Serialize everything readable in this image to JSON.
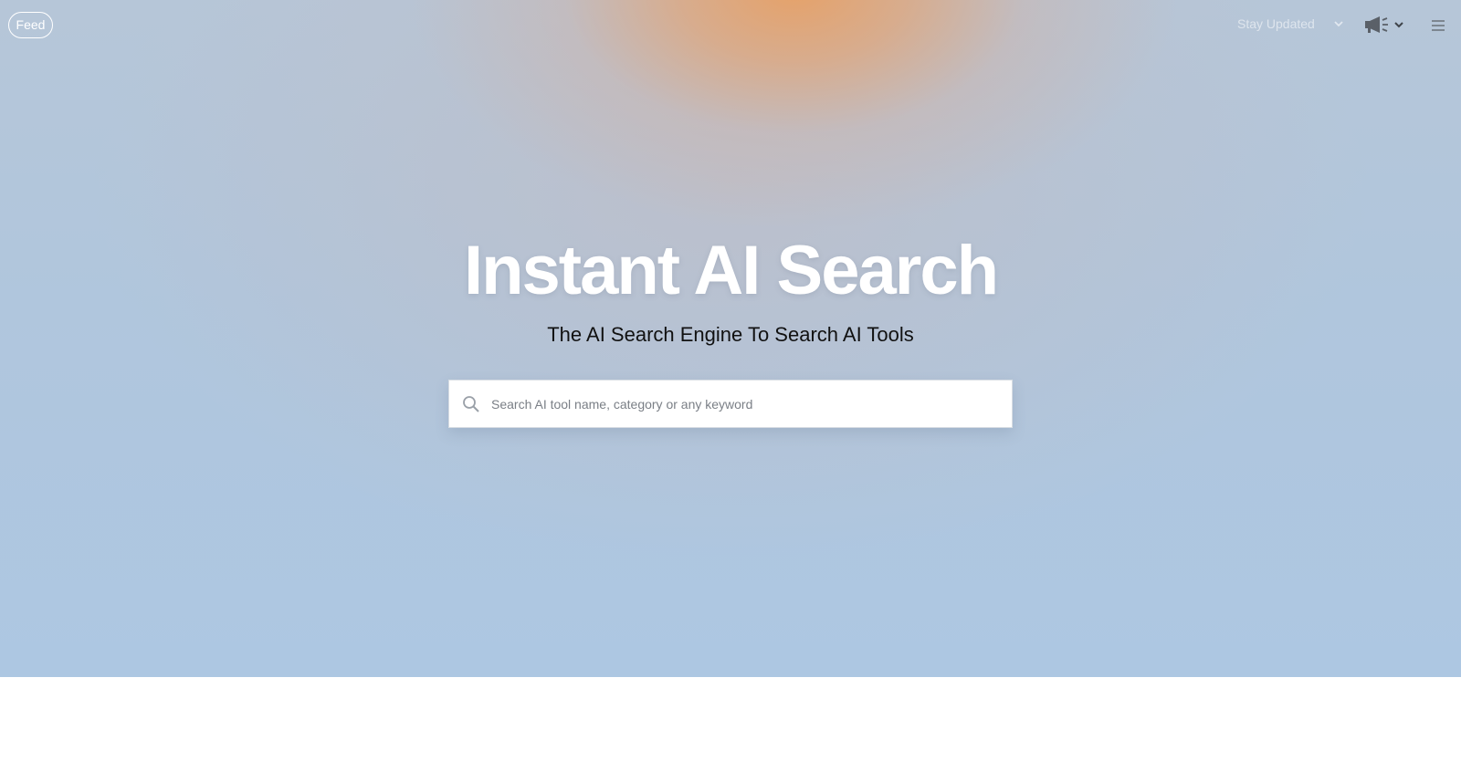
{
  "nav": {
    "feed_label": "Feed",
    "stay_updated_label": "Stay Updated"
  },
  "hero": {
    "title": "Instant AI Search",
    "subtitle": "The AI Search Engine To Search AI Tools"
  },
  "search": {
    "placeholder": "Search AI tool name, category or any keyword",
    "value": ""
  },
  "colors": {
    "hero_top_glow": "#e8a064",
    "hero_base": "#b0c6dd",
    "title_text": "#ffffff",
    "subtitle_text": "#111111"
  },
  "icons": {
    "search": "search-icon",
    "announce": "megaphone-icon",
    "menu": "hamburger-menu-icon",
    "dropdown": "chevron-down-icon"
  }
}
